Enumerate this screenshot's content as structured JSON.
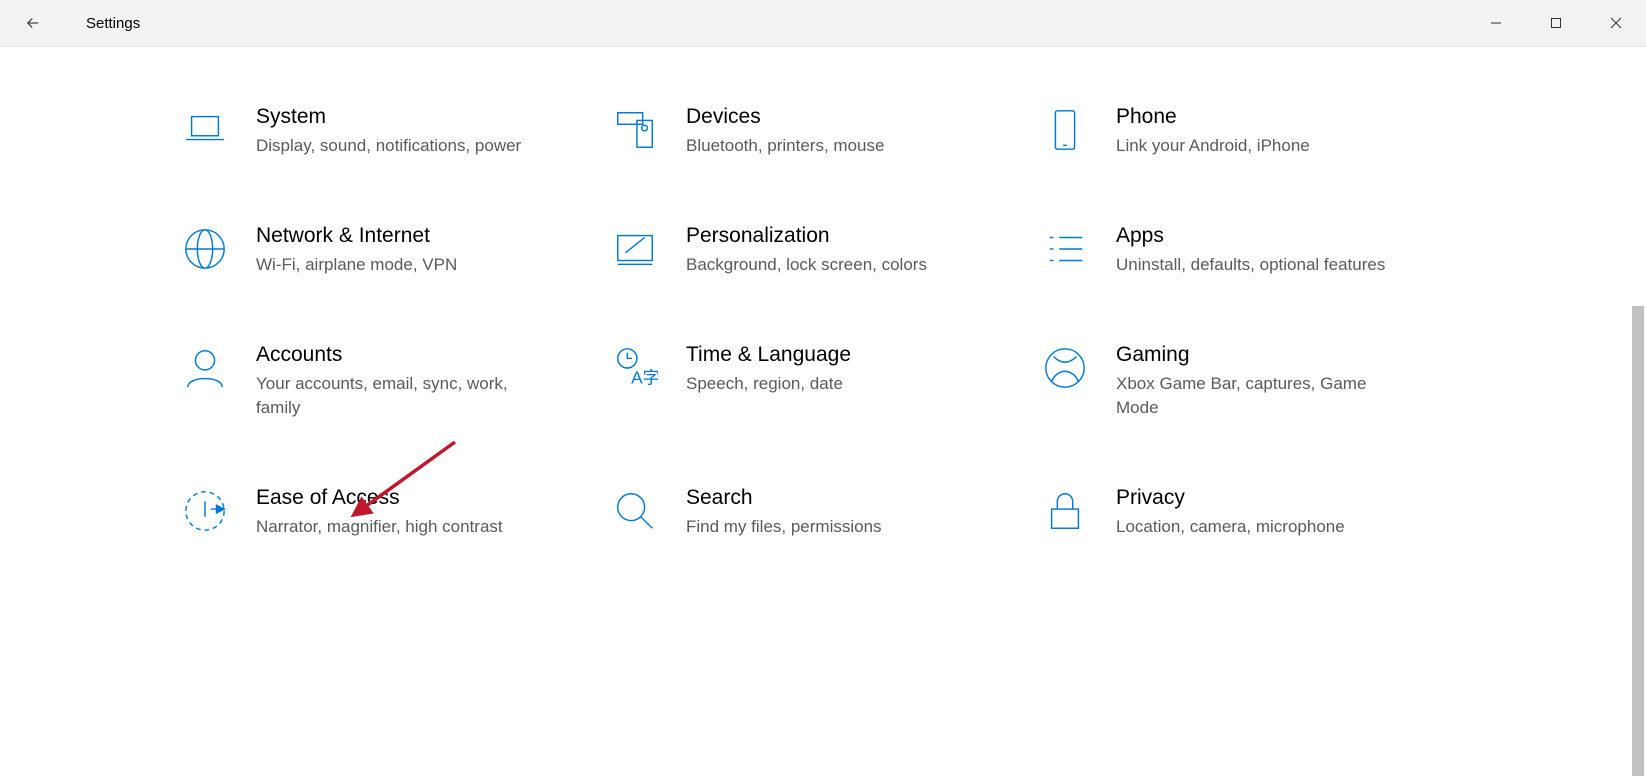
{
  "window": {
    "title": "Settings"
  },
  "categories": [
    {
      "key": "system",
      "title": "System",
      "desc": "Display, sound, notifications, power"
    },
    {
      "key": "devices",
      "title": "Devices",
      "desc": "Bluetooth, printers, mouse"
    },
    {
      "key": "phone",
      "title": "Phone",
      "desc": "Link your Android, iPhone"
    },
    {
      "key": "network",
      "title": "Network & Internet",
      "desc": "Wi-Fi, airplane mode, VPN"
    },
    {
      "key": "personalization",
      "title": "Personalization",
      "desc": "Background, lock screen, colors"
    },
    {
      "key": "apps",
      "title": "Apps",
      "desc": "Uninstall, defaults, optional features"
    },
    {
      "key": "accounts",
      "title": "Accounts",
      "desc": "Your accounts, email, sync, work, family"
    },
    {
      "key": "time",
      "title": "Time & Language",
      "desc": "Speech, region, date"
    },
    {
      "key": "gaming",
      "title": "Gaming",
      "desc": "Xbox Game Bar, captures, Game Mode"
    },
    {
      "key": "ease",
      "title": "Ease of Access",
      "desc": "Narrator, magnifier, high contrast"
    },
    {
      "key": "search",
      "title": "Search",
      "desc": "Find my files, permissions"
    },
    {
      "key": "privacy",
      "title": "Privacy",
      "desc": "Location, camera, microphone"
    }
  ],
  "annotation": {
    "target": "accounts"
  }
}
